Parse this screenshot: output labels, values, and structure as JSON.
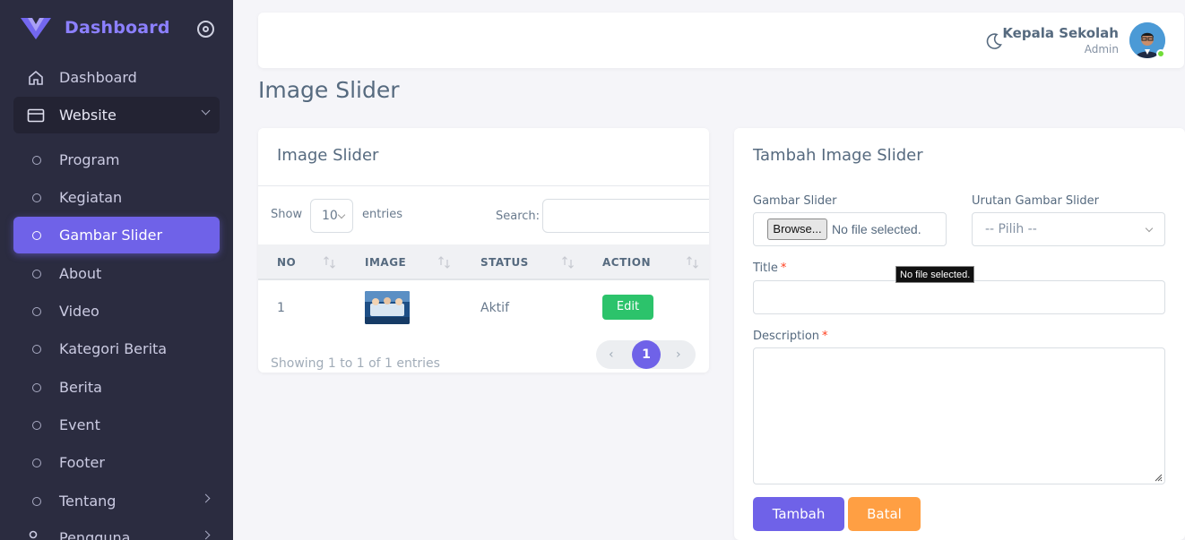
{
  "brand": {
    "name": "Dashboard"
  },
  "sidebar": {
    "items": [
      {
        "label": "Dashboard",
        "icon": "home-icon"
      },
      {
        "label": "Website",
        "icon": "browser-window-icon"
      },
      {
        "label": "Program"
      },
      {
        "label": "Kegiatan"
      },
      {
        "label": "Gambar Slider"
      },
      {
        "label": "About"
      },
      {
        "label": "Video"
      },
      {
        "label": "Kategori Berita"
      },
      {
        "label": "Berita"
      },
      {
        "label": "Event"
      },
      {
        "label": "Footer"
      },
      {
        "label": "Tentang"
      },
      {
        "label": "Pengguna",
        "icon": "users-icon"
      }
    ]
  },
  "navbar": {
    "user_name": "Kepala Sekolah",
    "user_role": "Admin"
  },
  "page": {
    "title": "Image Slider"
  },
  "list_card": {
    "title": "Image Slider",
    "show_label": "Show",
    "page_size": "10",
    "entries_label": "entries",
    "search_label": "Search:",
    "columns": [
      "NO",
      "IMAGE",
      "STATUS",
      "ACTION"
    ],
    "rows": [
      {
        "no": "1",
        "status": "Aktif",
        "action": "Edit"
      }
    ],
    "showing": "Showing 1 to 1 of 1 entries",
    "pagination": {
      "prev": "‹",
      "current": "1",
      "next": "›"
    }
  },
  "form_card": {
    "title": "Tambah Image Slider",
    "gambar_label": "Gambar Slider",
    "browse_label": "Browse...",
    "no_file": "No file selected.",
    "tooltip": "No file selected.",
    "urutan_label": "Urutan Gambar Slider",
    "urutan_placeholder": "-- Pilih --",
    "title_label": "Title",
    "description_label": "Description",
    "required_mark": "*",
    "submit_label": "Tambah",
    "cancel_label": "Batal"
  },
  "colors": {
    "primary": "#6f62e8",
    "success": "#2cc36b",
    "warning": "#ff9f43",
    "sidebar": "#2b2c40"
  }
}
